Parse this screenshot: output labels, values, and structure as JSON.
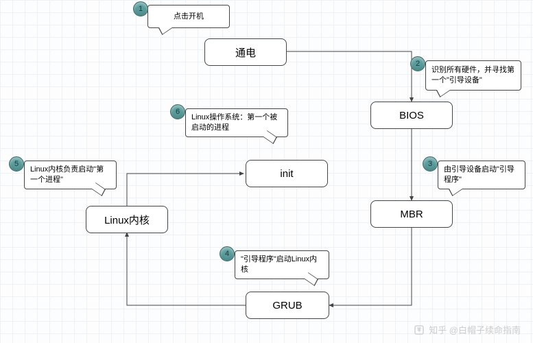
{
  "nodes": {
    "power": {
      "label": "通电"
    },
    "bios": {
      "label": "BIOS"
    },
    "mbr": {
      "label": "MBR"
    },
    "grub": {
      "label": "GRUB"
    },
    "kernel": {
      "label": "Linux内核"
    },
    "init": {
      "label": "init"
    }
  },
  "callouts": {
    "c1": {
      "num": "1",
      "text": "点击开机"
    },
    "c2": {
      "num": "2",
      "text": "识别所有硬件，并寻找第一个\"引导设备\""
    },
    "c3": {
      "num": "3",
      "text": "由引导设备启动\"引导程序\""
    },
    "c4": {
      "num": "4",
      "text": "\"引导程序\"启动Linux内核"
    },
    "c5": {
      "num": "5",
      "text": "Linux内核负责启动\"第一个进程\""
    },
    "c6": {
      "num": "6",
      "text": "Linux操作系统：第一个被启动的进程"
    }
  },
  "flow_order": [
    "power",
    "bios",
    "mbr",
    "grub",
    "kernel",
    "init"
  ],
  "watermark": {
    "text": "知乎 @白帽子续命指南"
  }
}
